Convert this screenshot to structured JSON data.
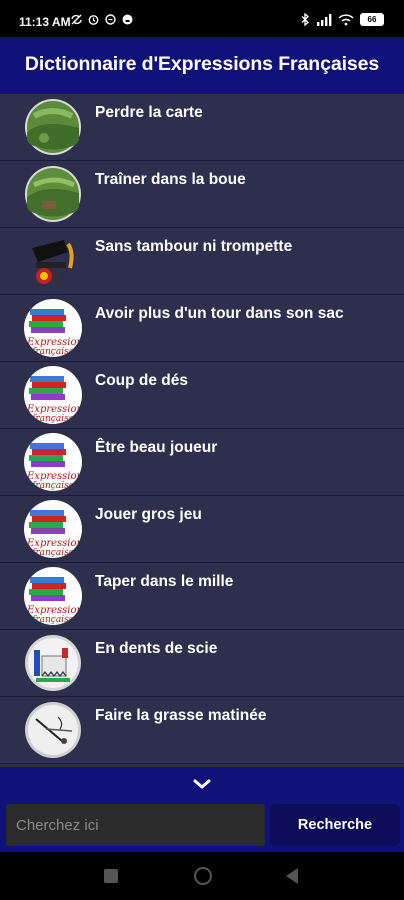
{
  "status": {
    "time": "11:13 AM",
    "battery": "66"
  },
  "app": {
    "title": "Dictionnaire d'Expressions Françaises"
  },
  "list": [
    {
      "label": "Perdre la carte",
      "icon": "field-photo-icon"
    },
    {
      "label": "Traîner dans la boue",
      "icon": "field-photo-icon"
    },
    {
      "label": "Sans tambour ni trompette",
      "icon": "instruments-icon"
    },
    {
      "label": "Avoir plus d'un tour dans son sac",
      "icon": "books-icon"
    },
    {
      "label": "Coup de dés",
      "icon": "books-icon"
    },
    {
      "label": "Être beau joueur",
      "icon": "books-icon"
    },
    {
      "label": "Jouer gros jeu",
      "icon": "books-icon"
    },
    {
      "label": "Taper dans le mille",
      "icon": "books-icon"
    },
    {
      "label": "En dents de scie",
      "icon": "saw-illustration-icon"
    },
    {
      "label": "Faire la grasse matinée",
      "icon": "clock-sketch-icon"
    }
  ],
  "search": {
    "placeholder": "Cherchez ici",
    "button_label": "Recherche"
  },
  "colors": {
    "appbar": "#11117a",
    "list_bg": "#2e2f4c",
    "button_bg": "#0d0d5a"
  }
}
